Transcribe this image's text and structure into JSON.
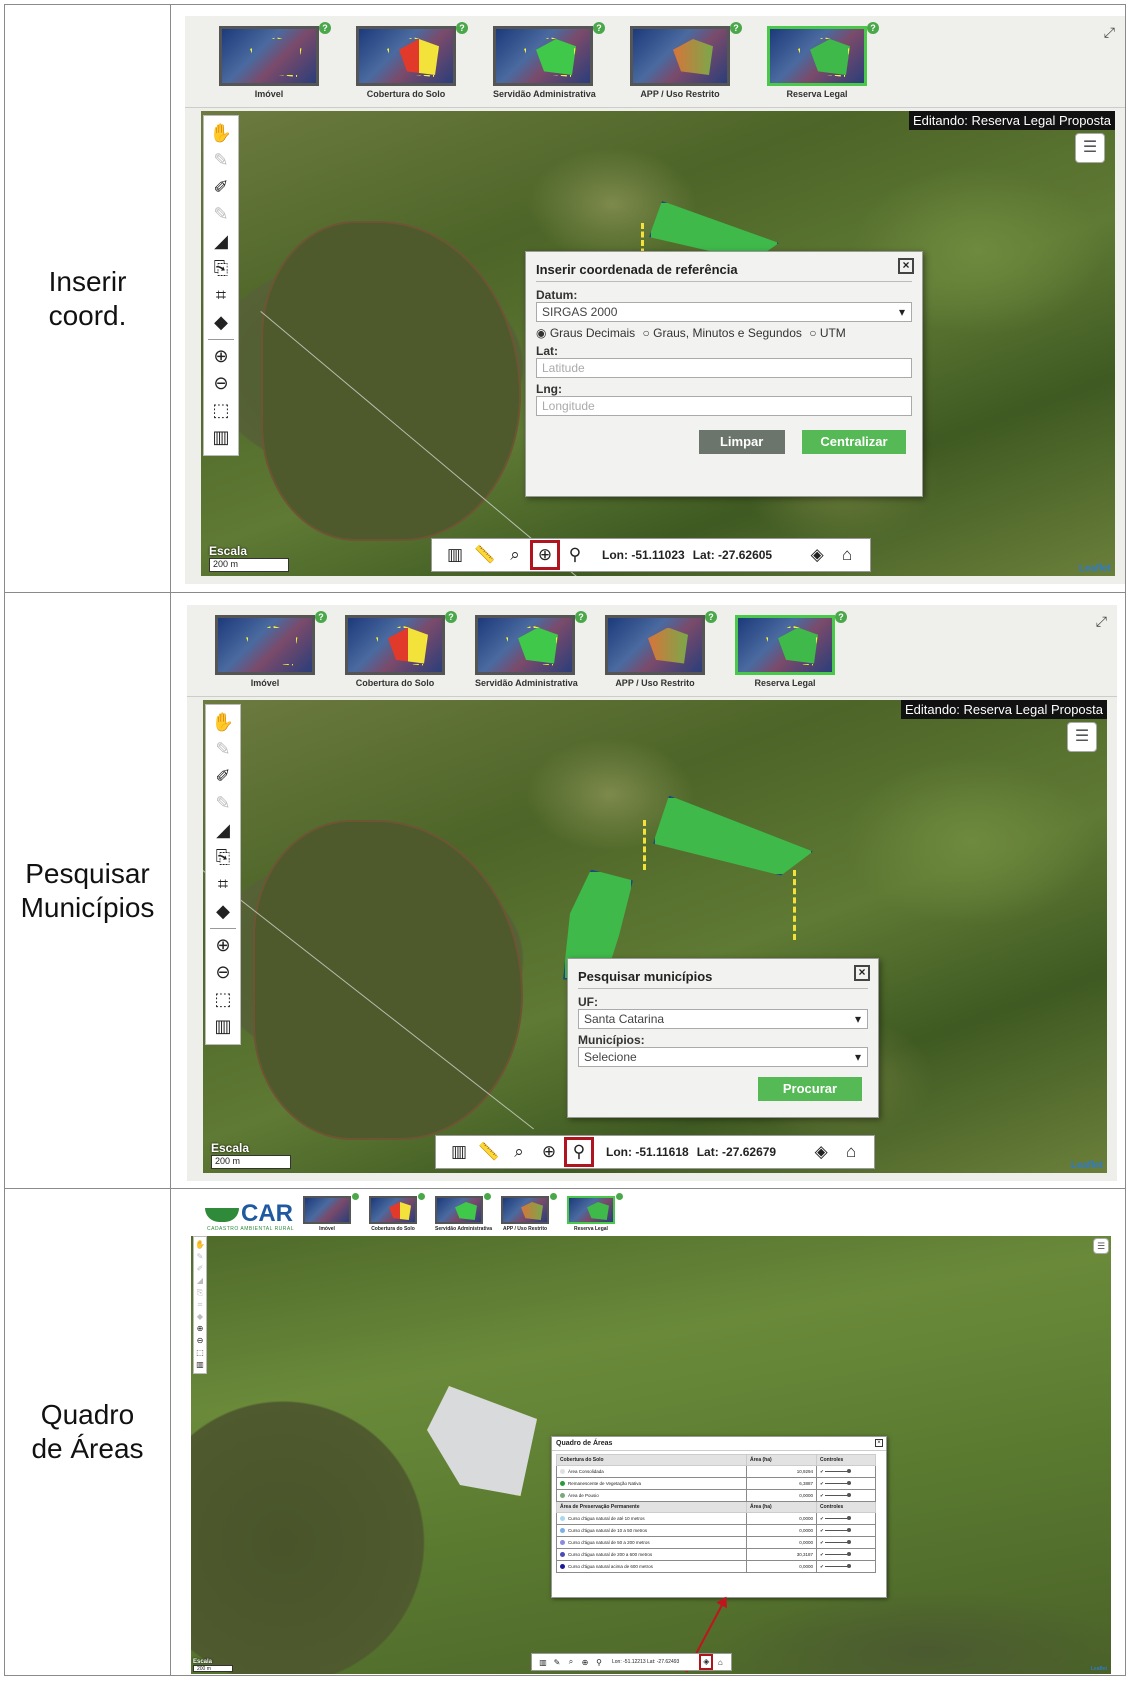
{
  "rows": [
    {
      "label": "Inserir\ncoord.",
      "editing": "Editando: Reserva Legal Proposta",
      "thumbs": [
        "Imóvel",
        "Cobertura do Solo",
        "Servidão Administrativa",
        "APP / Uso Restrito",
        "Reserva Legal"
      ],
      "dialog": {
        "title": "Inserir coordenada de referência",
        "datum_label": "Datum:",
        "datum_value": "SIRGAS 2000",
        "radio_options": [
          "Graus Decimais",
          "Graus, Minutos e Segundos",
          "UTM"
        ],
        "lat_label": "Lat:",
        "lat_placeholder": "Latitude",
        "lng_label": "Lng:",
        "lng_placeholder": "Longitude",
        "clear_button": "Limpar",
        "center_button": "Centralizar"
      },
      "scale_label": "Escala",
      "scale_value": "200 m",
      "lon": "Lon: -51.11023",
      "lat": "Lat: -27.62605",
      "leaflet": "Leaflet"
    },
    {
      "label": "Pesquisar\nMunicípios",
      "editing": "Editando: Reserva Legal Proposta",
      "thumbs": [
        "Imóvel",
        "Cobertura do Solo",
        "Servidão Administrativa",
        "APP / Uso Restrito",
        "Reserva Legal"
      ],
      "dialog": {
        "title": "Pesquisar municípios",
        "uf_label": "UF:",
        "uf_value": "Santa Catarina",
        "mun_label": "Municípios:",
        "mun_value": "Selecione",
        "search_button": "Procurar"
      },
      "scale_label": "Escala",
      "scale_value": "200 m",
      "lon": "Lon: -51.11618",
      "lat": "Lat: -27.62679",
      "leaflet": "Leaflet"
    },
    {
      "label": "Quadro\nde Áreas",
      "logo": "CAR",
      "logo_sub": "CADASTRO AMBIENTAL RURAL",
      "thumbs": [
        "Imóvel",
        "Cobertura do Solo",
        "Servidão Administrativa",
        "APP / Uso Restrito",
        "Reserva Legal"
      ],
      "quadro": {
        "title": "Quadro de Áreas",
        "section1_header": [
          "Cobertura do Solo",
          "Área (ha)",
          "Controles"
        ],
        "section1_rows": [
          {
            "name": "Área Consolidada",
            "value": "10,9294"
          },
          {
            "name": "Remanescente de Vegetação Nativa",
            "value": "6,3887"
          },
          {
            "name": "Área de Pousio",
            "value": "0,0000"
          }
        ],
        "section2_header": [
          "Área de Preservação Permanente",
          "Área (ha)",
          "Controles"
        ],
        "section2_rows": [
          {
            "name": "Curso d'água natural de até 10 metros",
            "value": "0,0000"
          },
          {
            "name": "Curso d'água natural de 10 a 50 metros",
            "value": "0,0000"
          },
          {
            "name": "Curso d'água natural de 50 a 200 metros",
            "value": "0,0000"
          },
          {
            "name": "Curso d'água natural de 200 a 600 metros",
            "value": "30,3187"
          },
          {
            "name": "Curso d'água natural acima de 600 metros",
            "value": "0,0000"
          }
        ]
      },
      "scale_label": "Escala",
      "scale_value": "200 m",
      "lon": "Lon: -51.12213",
      "lat": "Lat: -27.62493",
      "leaflet": "Leaflet"
    }
  ],
  "colors": {
    "active_thumb": "#49c849",
    "highlight": "#b0141e",
    "button_green": "#55b955",
    "button_gray": "#6c756c",
    "polygon_green": "#3fb94a"
  },
  "icons": [
    "hand-icon",
    "draw-line-icon",
    "magic-wand-icon",
    "add-vertex-icon",
    "import-icon",
    "crop-icon",
    "eraser-icon",
    "zoom-in-icon",
    "zoom-out-icon",
    "zoom-box-icon",
    "map-icon",
    "ruler-icon",
    "search-location-icon",
    "crosshair-icon",
    "municipality-search-icon",
    "layers-icon",
    "bank-icon"
  ]
}
